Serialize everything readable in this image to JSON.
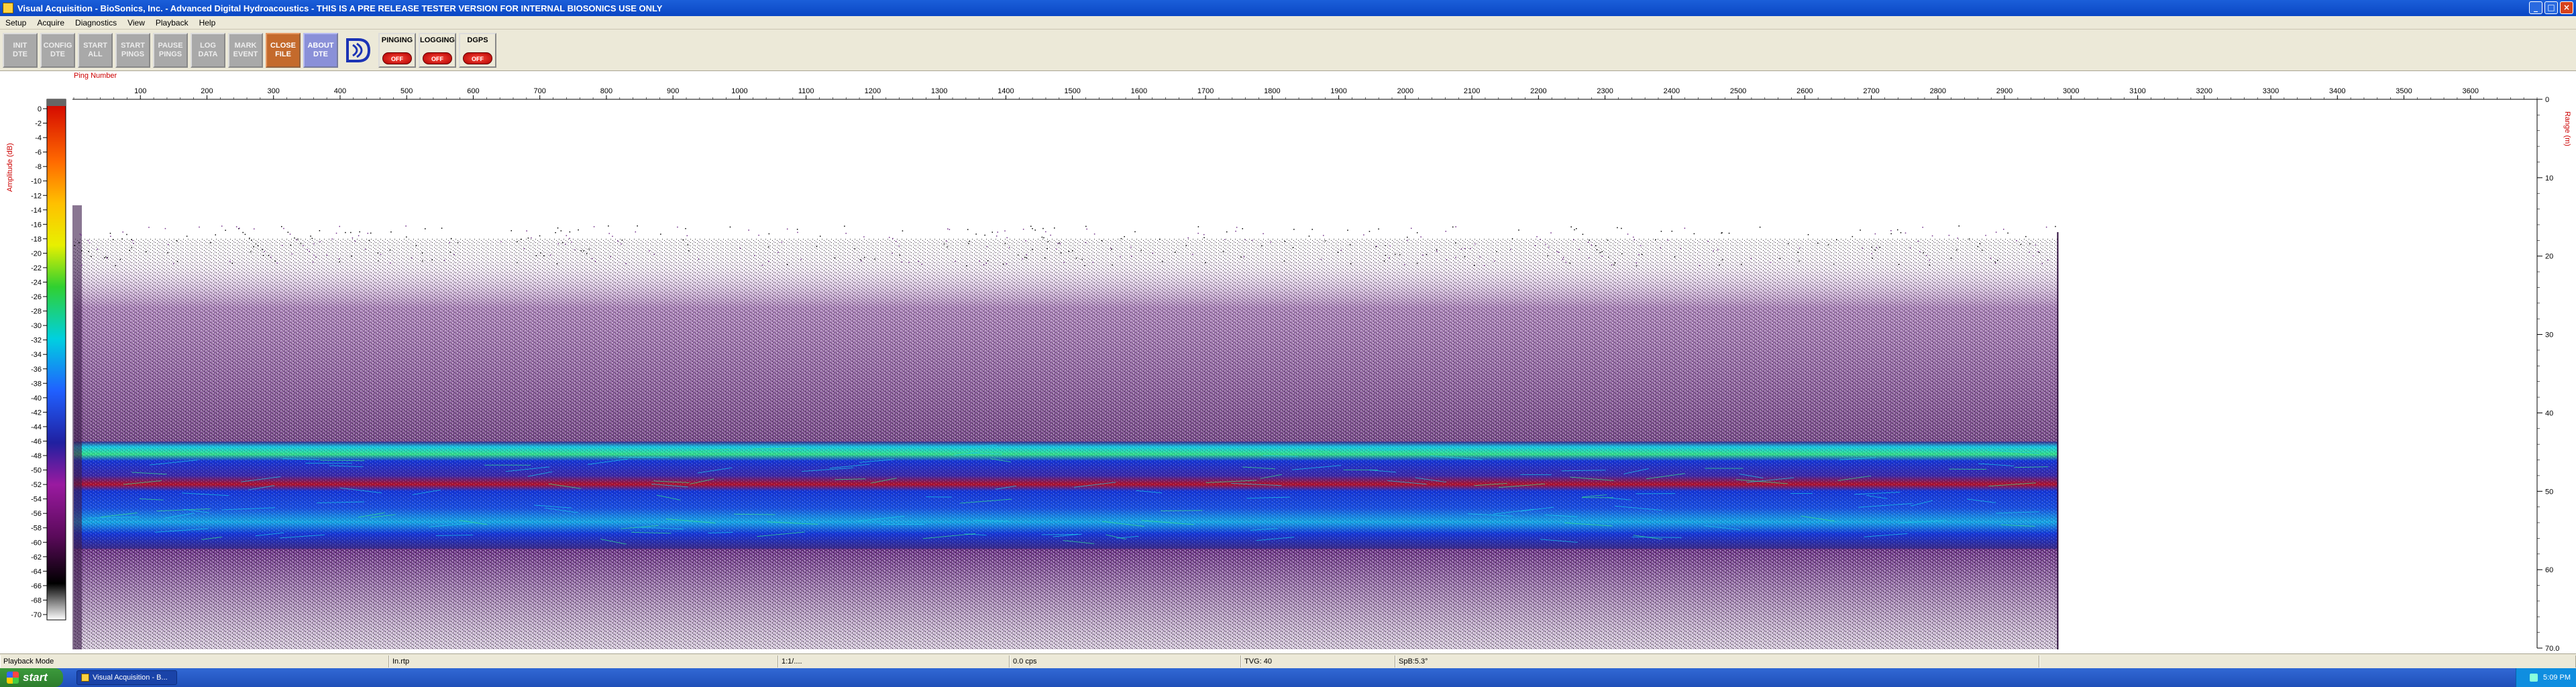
{
  "window": {
    "title": "Visual Acquisition  -  BioSonics, Inc.  -  Advanced Digital Hydroacoustics  -  THIS IS A PRE RELEASE TESTER VERSION FOR INTERNAL BIOSONICS USE ONLY",
    "icon": "app-icon"
  },
  "menu": [
    "Setup",
    "Acquire",
    "Diagnostics",
    "View",
    "Playback",
    "Help"
  ],
  "toolbar": {
    "buttons": [
      {
        "name": "init-dte-button",
        "label": "INIT\nDTE"
      },
      {
        "name": "config-dte-button",
        "label": "CONFIG\nDTE"
      },
      {
        "name": "start-all-button",
        "label": "START\nALL"
      },
      {
        "name": "start-pings-button",
        "label": "START\nPINGS"
      },
      {
        "name": "pause-pings-button",
        "label": "PAUSE\nPINGS"
      },
      {
        "name": "log-data-button",
        "label": "LOG\nDATA"
      },
      {
        "name": "mark-event-button",
        "label": "MARK\nEVENT"
      },
      {
        "name": "close-file-button",
        "label": "CLOSE\nFILE"
      },
      {
        "name": "about-dte-button",
        "label": "ABOUT\nDTE"
      }
    ],
    "toggles": [
      {
        "name": "pinging-toggle",
        "label": "PINGING",
        "state": "OFF"
      },
      {
        "name": "logging-toggle",
        "label": "LOGGING",
        "state": "OFF"
      },
      {
        "name": "dgps-toggle",
        "label": "DGPS",
        "state": "OFF"
      }
    ]
  },
  "echogram": {
    "ping_axis_label": "Ping Number",
    "ping_ticks": [
      100,
      200,
      300,
      400,
      500,
      600,
      700,
      800,
      900,
      1000,
      1100,
      1200,
      1300,
      1400,
      1500,
      1600,
      1700,
      1800,
      1900,
      2000,
      2100,
      2200,
      2300,
      2400,
      2500,
      2600,
      2700,
      2800,
      2900,
      3000,
      3100,
      3200,
      3300,
      3400,
      3500,
      3600
    ],
    "ping_range": [
      0,
      3700
    ],
    "amplitude_label": "Amplitude (dB)",
    "amplitude_ticks": [
      0,
      -2,
      -4,
      -6,
      -8,
      -10,
      -12,
      -14,
      -16,
      -18,
      -20,
      -22,
      -24,
      -26,
      -28,
      -30,
      -32,
      -34,
      -36,
      -38,
      -40,
      -42,
      -44,
      -46,
      -48,
      -50,
      -52,
      -54,
      -56,
      -58,
      -60,
      -62,
      -64,
      -66,
      -68,
      -70
    ],
    "range_label": "Range (m)",
    "range_ticks": [
      "0",
      "10",
      "20",
      "30",
      "40",
      "50",
      "60",
      "70.0"
    ],
    "range_max": 70,
    "data_end_ping": 2980,
    "colors": {
      "purple": "#6e2a86",
      "blue": "#1637d8",
      "cyan": "#19c8e6",
      "green": "#35e08a",
      "red": "#b3122b"
    }
  },
  "statusbar": {
    "mode": "Playback Mode",
    "cells": [
      "In.rtp",
      "1:1/....",
      "0.0 cps",
      "TVG: 40",
      "SpB:5.3°"
    ]
  },
  "taskbar": {
    "start_label": "start",
    "task_label": "Visual Acquisition  -  B...",
    "clock": "5:09 PM"
  }
}
